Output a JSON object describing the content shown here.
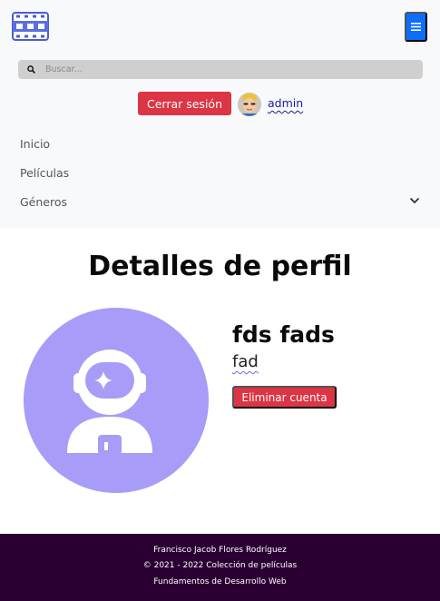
{
  "navbar": {
    "brand_icon": "film-strip-icon",
    "toggle_icon": "hamburger-icon",
    "search": {
      "placeholder": "Buscar...",
      "value": ""
    },
    "logout_label": "Cerrar sesión",
    "username": "admin",
    "links": [
      {
        "label": "Inicio"
      },
      {
        "label": "Películas"
      },
      {
        "label": "Géneros",
        "has_dropdown": true
      }
    ]
  },
  "profile": {
    "title": "Detalles de perfil",
    "full_name": "fds fads",
    "handle": "fad",
    "delete_label": "Eliminar cuenta",
    "avatar_icon": "astronaut-icon"
  },
  "footer": {
    "lines": [
      "Francisco Jacob Flores Rodríguez",
      "© 2021 - 2022 Colección de películas",
      "Fundamentos de Desarrollo Web"
    ]
  },
  "colors": {
    "primary": "#0d6efd",
    "danger": "#dc3545",
    "avatar_bg": "#a79cf7",
    "footer_bg": "#2a0033",
    "navbar_bg": "#f8f9fa"
  }
}
